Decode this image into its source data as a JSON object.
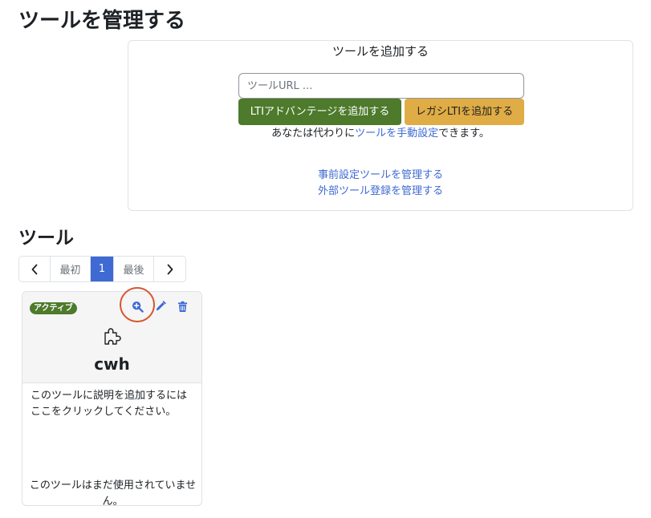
{
  "page": {
    "title": "ツールを管理する"
  },
  "add_tool": {
    "title": "ツールを追加する",
    "url_placeholder": "ツールURL ...",
    "url_value": "",
    "lti_advantage_button": "LTIアドバンテージを追加する",
    "legacy_lti_button": "レガシLTIを追加する",
    "manual_prefix": "あなたは代わりに",
    "manual_link": "ツールを手動設定",
    "manual_suffix": "できます。",
    "preconfigured_link": "事前設定ツールを管理する",
    "external_registration_link": "外部ツール登録を管理する"
  },
  "tools_section": {
    "title": "ツール",
    "pagination": {
      "prev_icon": "chevron-left-icon",
      "first": "最初",
      "current": "1",
      "last": "最後",
      "next_icon": "chevron-right-icon"
    }
  },
  "tool_card": {
    "status_badge": "アクティブ",
    "actions": [
      "zoom-in-icon",
      "pencil-icon",
      "trash-icon"
    ],
    "icon": "puzzle-piece-icon",
    "name": "cwh",
    "description": "このツールに説明を追加するにはここをクリックしてください。",
    "usage": "このツールはまだ使用されていません。"
  },
  "colors": {
    "primary": "#3f6ad3",
    "success": "#4d7a2b",
    "warning": "#e0ac45",
    "highlight_ring": "#d9542b"
  }
}
